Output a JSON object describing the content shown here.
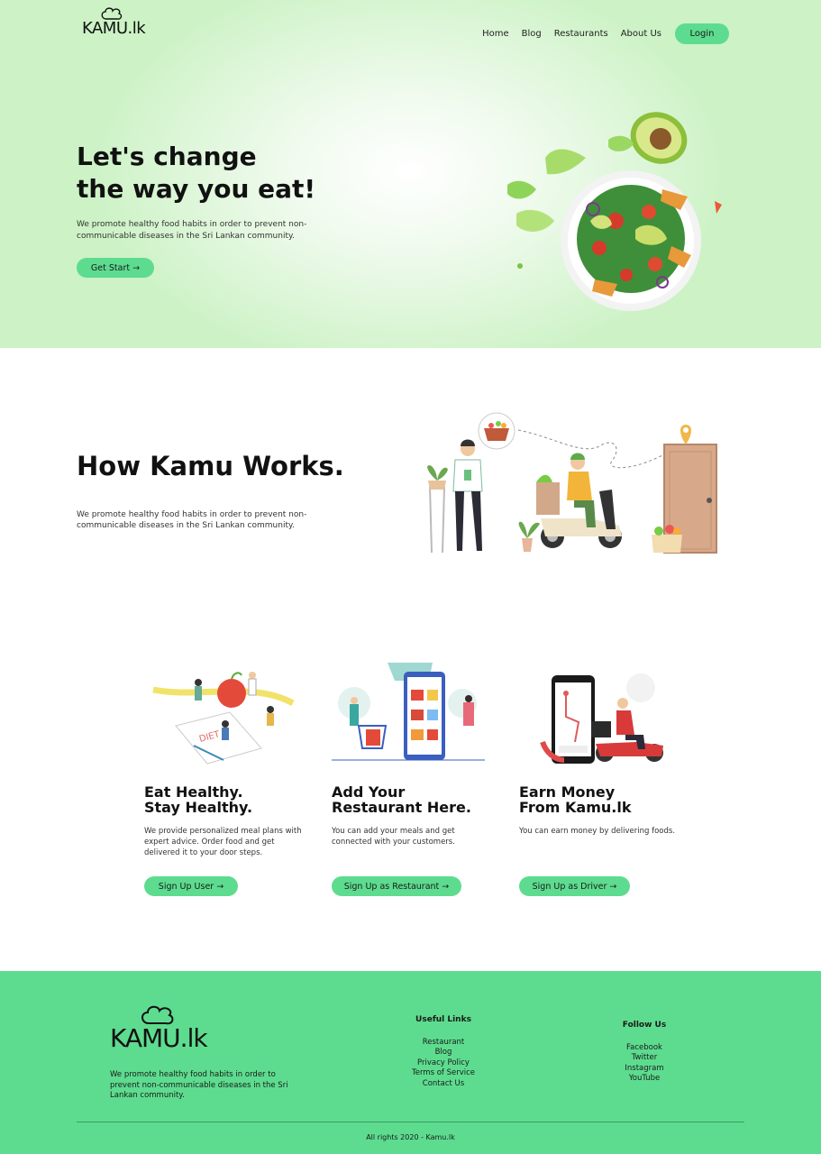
{
  "brand": {
    "logo_text": "KAMU.lk"
  },
  "nav": {
    "items": [
      "Home",
      "Blog",
      "Restaurants",
      "About Us"
    ],
    "login_label": "Login"
  },
  "hero": {
    "title_line1": "Let's change",
    "title_line2": "the way you eat!",
    "description": "We promote healthy food habits in order to prevent non-communicable diseases in the Sri Lankan community.",
    "cta_label": "Get Start →"
  },
  "how": {
    "title": "How Kamu Works.",
    "description": "We promote healthy food habits in order to prevent non-communicable diseases in the Sri Lankan community."
  },
  "features": [
    {
      "title_line1": "Eat Healthy.",
      "title_line2": "Stay Healthy.",
      "description": "We provide personalized meal plans with expert advice. Order food and get delivered it to your door steps.",
      "cta_label": "Sign Up User →"
    },
    {
      "title_line1": "Add Your",
      "title_line2": "Restaurant Here.",
      "description": "You can add your meals and get connected with your customers.",
      "cta_label": "Sign Up as Restaurant →"
    },
    {
      "title_line1": "Earn Money",
      "title_line2": "From Kamu.lk",
      "description": "You can earn money by delivering foods.",
      "cta_label": "Sign Up as Driver →"
    }
  ],
  "footer": {
    "logo_text": "KAMU.lk",
    "description": "We promote healthy food habits in order to prevent non-communicable diseases in the Sri Lankan community.",
    "useful_links_title": "Useful Links",
    "useful_links": [
      "Restaurant",
      "Blog",
      "Privacy Policy",
      "Terms of Service",
      "Contact Us"
    ],
    "follow_title": "Follow Us",
    "follow_links": [
      "Facebook",
      "Twitter",
      "Instagram",
      "YouTube"
    ],
    "copyright": "All rights 2020 - Kamu.lk"
  },
  "colors": {
    "accent": "#5ddc8f",
    "hero_bg": "#ccf2c5",
    "text": "#111111"
  },
  "icons": [
    "chef-hat-icon",
    "salad-bowl-illustration",
    "delivery-illustration",
    "healthy-illustration",
    "restaurant-app-illustration",
    "driver-illustration"
  ]
}
